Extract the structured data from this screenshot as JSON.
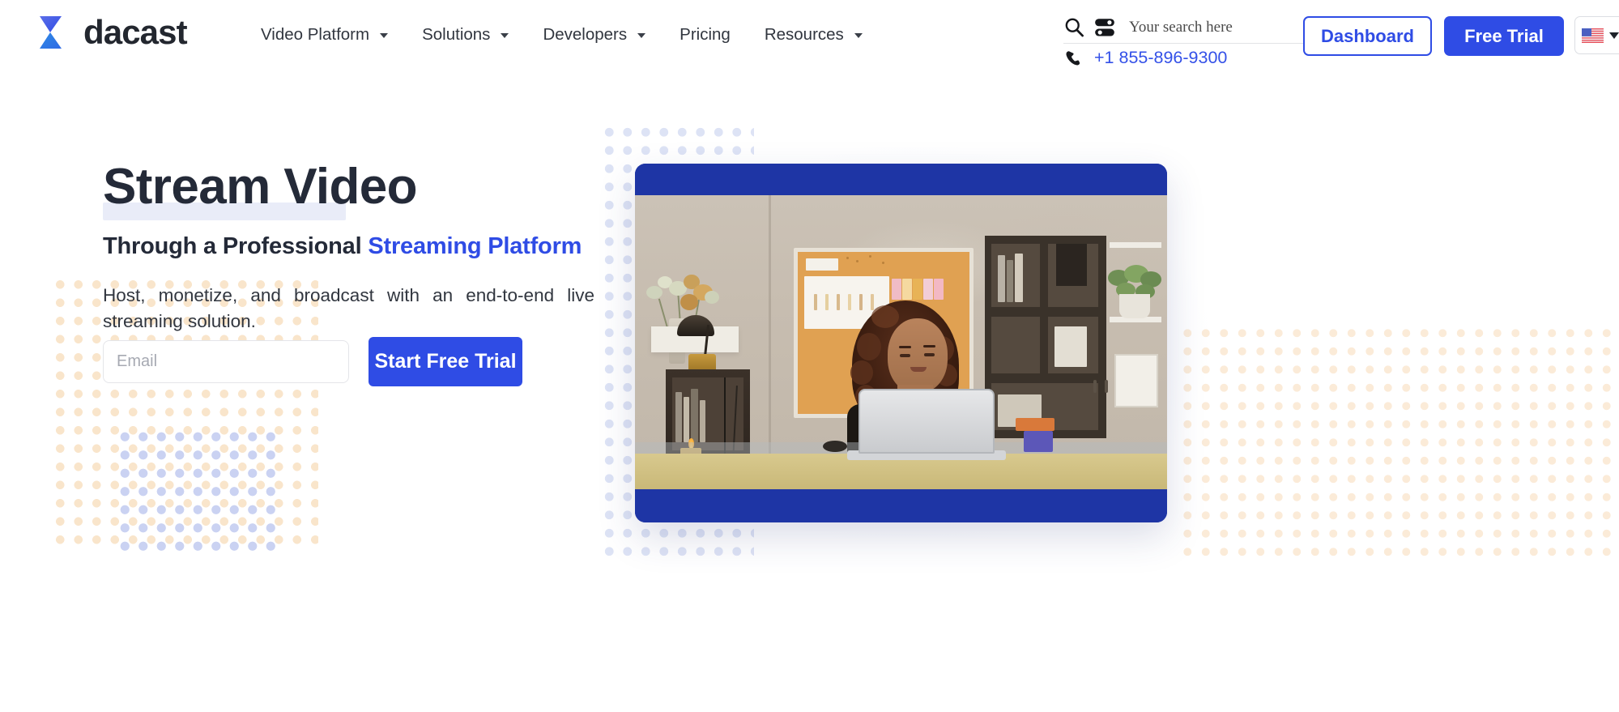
{
  "header": {
    "logo": {
      "text": "dacast",
      "icon": "dacast-chevron-logo"
    },
    "nav_items": [
      {
        "label": "Video Platform",
        "has_dropdown": true
      },
      {
        "label": "Solutions",
        "has_dropdown": true
      },
      {
        "label": "Developers",
        "has_dropdown": true
      },
      {
        "label": "Pricing",
        "has_dropdown": false
      },
      {
        "label": "Resources",
        "has_dropdown": true
      }
    ],
    "search": {
      "placeholder": "Your search here",
      "value": "",
      "search_icon": "search-icon",
      "filter_icon": "filter-toggle-icon"
    },
    "phone": {
      "icon": "phone-icon",
      "number": "+1 855-896-9300"
    },
    "dashboard_label": "Dashboard",
    "free_trial_label": "Free Trial",
    "language": {
      "flag": "us-flag",
      "caret": "chevron-down-icon"
    }
  },
  "hero": {
    "title": "Stream Video",
    "subtitle_plain": "Through a Professional ",
    "subtitle_accent": "Streaming Platform",
    "description": "Host, monetize, and broadcast with an end-to-end live streaming solution.",
    "email_placeholder": "Email",
    "email_value": "",
    "cta_label": "Start Free Trial"
  },
  "media": {
    "caption": "Woman with curly hair smiling at a laptop in a home office with cork board, shelves and plants",
    "player_bar_color": "#1e35a5"
  },
  "colors": {
    "brand_blue": "#2f4ce5",
    "deep_blue": "#1e35a5",
    "ink": "#242a38",
    "body_text": "#31363f",
    "dot_peach": "#f8dfc0",
    "dot_blue": "#c4cdf0",
    "highlight": "#e9ecf8"
  }
}
